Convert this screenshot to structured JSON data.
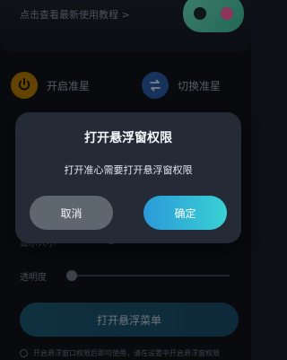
{
  "banner": {
    "tutorial_link": "点击查看最新使用教程 >",
    "image_icon": "gamepad-icon"
  },
  "actions": {
    "enable_crosshair": "开启准星",
    "switch_crosshair": "切换准星"
  },
  "settings": {
    "opacity_label": "透明度",
    "partial_label": "显示大小"
  },
  "main_button": "打开悬浮菜单",
  "bottom_note": "开启悬浮窗口权限后即可使用，请在设置中开启悬浮窗权限",
  "dialog": {
    "title": "打开悬浮窗权限",
    "message": "打开准心需要打开悬浮窗权限",
    "cancel": "取消",
    "confirm": "确定"
  },
  "colors": {
    "background": "#0f131a",
    "dialog_bg": "#242b36",
    "confirm_gradient_start": "#2a9ad8",
    "confirm_gradient_end": "#3ad1d4",
    "cancel_bg": "#5e6670"
  }
}
